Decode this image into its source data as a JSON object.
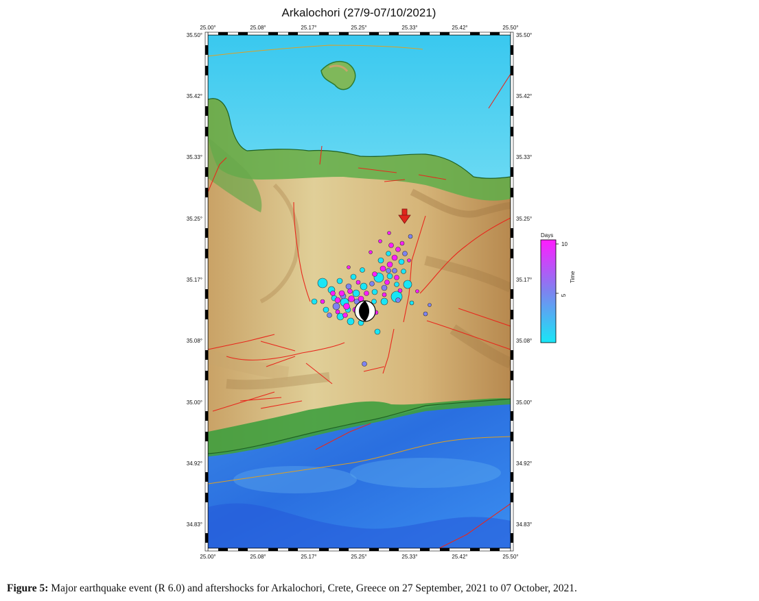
{
  "map": {
    "title": "Arkalochori (27/9-07/10/2021)",
    "lon_ticks": [
      "25.00°",
      "25.08°",
      "25.17°",
      "25.25°",
      "25.33°",
      "25.42°",
      "25.50°"
    ],
    "lat_ticks": [
      "35.50°",
      "35.42°",
      "35.33°",
      "35.25°",
      "35.17°",
      "35.08°",
      "35.00°",
      "34.92°",
      "34.83°"
    ],
    "colors": {
      "sea_deep": "#2f6fe0",
      "sea_shallow": "#7fe0f4",
      "land_low": "#d9c488",
      "land_high": "#b98a52",
      "coast_green": "#2e9c3a",
      "fault": "#e8271c",
      "boundary": "#e0a020",
      "early_events": "#19e6f6",
      "late_events": "#ff1cff",
      "mainshock_arrow": "#e0261c"
    }
  },
  "legend": {
    "title": "Days",
    "axis_label": "Time",
    "ticks": [
      "10",
      "5"
    ]
  },
  "caption": {
    "label": "Figure 5:",
    "text": " Major earthquake event (R 6.0) and aftershocks for Arkalochori, Crete, Greece on 27 September, 2021 to 07 October, 2021."
  }
}
